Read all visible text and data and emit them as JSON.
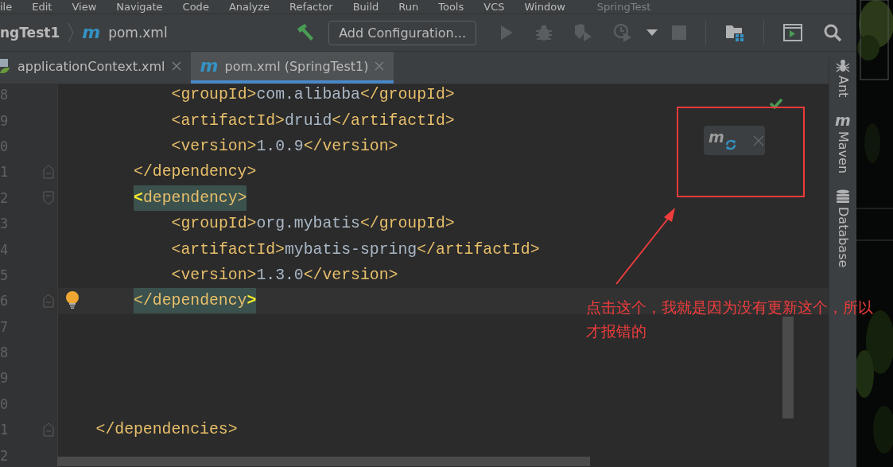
{
  "menu_bar": {
    "items": [
      "ile",
      "Edit",
      "View",
      "Navigate",
      "Code",
      "Analyze",
      "Refactor",
      "Build",
      "Run",
      "Tools",
      "VCS",
      "Window"
    ],
    "window_title": "SpringTest"
  },
  "breadcrumbs": {
    "project": "ngTest1",
    "file_icon": "m",
    "file": "pom.xml"
  },
  "toolbar": {
    "configuration_button": "Add Configuration..."
  },
  "tabs": [
    {
      "label": "applicationContext.xml",
      "kind": "spring",
      "selected": false
    },
    {
      "label": "pom.xml (SpringTest1)",
      "kind": "maven",
      "icon": "m",
      "selected": true
    }
  ],
  "editor": {
    "lines": [
      {
        "number": "8",
        "kind": "child",
        "segments": [
          {
            "kind": "tag",
            "text": "<groupId>"
          },
          {
            "kind": "text",
            "text": "com.alibaba"
          },
          {
            "kind": "tag",
            "text": "</groupId>"
          }
        ]
      },
      {
        "number": "9",
        "kind": "child",
        "segments": [
          {
            "kind": "tag",
            "text": "<artifactId>"
          },
          {
            "kind": "text",
            "text": "druid"
          },
          {
            "kind": "tag",
            "text": "</artifactId>"
          }
        ]
      },
      {
        "number": "0",
        "kind": "child",
        "segments": [
          {
            "kind": "tag",
            "text": "<version>"
          },
          {
            "kind": "text",
            "text": "1.0.9"
          },
          {
            "kind": "tag",
            "text": "</version>"
          }
        ]
      },
      {
        "number": "1",
        "kind": "close",
        "segments": [
          {
            "kind": "tag",
            "text": "</dependency>"
          }
        ]
      },
      {
        "number": "2",
        "kind": "open",
        "highlighted": true,
        "segments": [
          {
            "kind": "match",
            "text": "<"
          },
          {
            "kind": "tag",
            "text": "dependency>"
          }
        ]
      },
      {
        "number": "3",
        "kind": "child",
        "segments": [
          {
            "kind": "tag",
            "text": "<groupId>"
          },
          {
            "kind": "text",
            "text": "org.mybatis"
          },
          {
            "kind": "tag",
            "text": "</groupId>"
          }
        ]
      },
      {
        "number": "4",
        "kind": "child",
        "segments": [
          {
            "kind": "tag",
            "text": "<artifactId>"
          },
          {
            "kind": "text",
            "text": "mybatis-spring"
          },
          {
            "kind": "tag",
            "text": "</artifactId>"
          }
        ]
      },
      {
        "number": "5",
        "kind": "child",
        "segments": [
          {
            "kind": "tag",
            "text": "<version>"
          },
          {
            "kind": "text",
            "text": "1.3.0"
          },
          {
            "kind": "tag",
            "text": "</version>"
          }
        ]
      },
      {
        "number": "6",
        "kind": "close",
        "highlighted": true,
        "current": true,
        "intention": true,
        "segments": [
          {
            "kind": "tag",
            "text": "</dependency"
          },
          {
            "kind": "match",
            "text": ">"
          }
        ]
      },
      {
        "number": "7",
        "kind": "blank"
      },
      {
        "number": "8",
        "kind": "blank"
      },
      {
        "number": "9",
        "kind": "blank"
      },
      {
        "number": "0",
        "kind": "blank"
      },
      {
        "number": "1",
        "kind": "outer-close",
        "segments": [
          {
            "kind": "tag",
            "text": "</dependencies>"
          }
        ]
      },
      {
        "number": "2",
        "kind": "blank"
      }
    ]
  },
  "update_popup": {
    "icon": "m"
  },
  "tool_windows": [
    {
      "label": "Ant",
      "kind": "ant"
    },
    {
      "label": "Maven",
      "kind": "maven",
      "icon": "m"
    },
    {
      "label": "Database",
      "kind": "database"
    }
  ],
  "annotation": {
    "text": "点击这个，我就是因为没有更新这个，所以才报错的"
  }
}
